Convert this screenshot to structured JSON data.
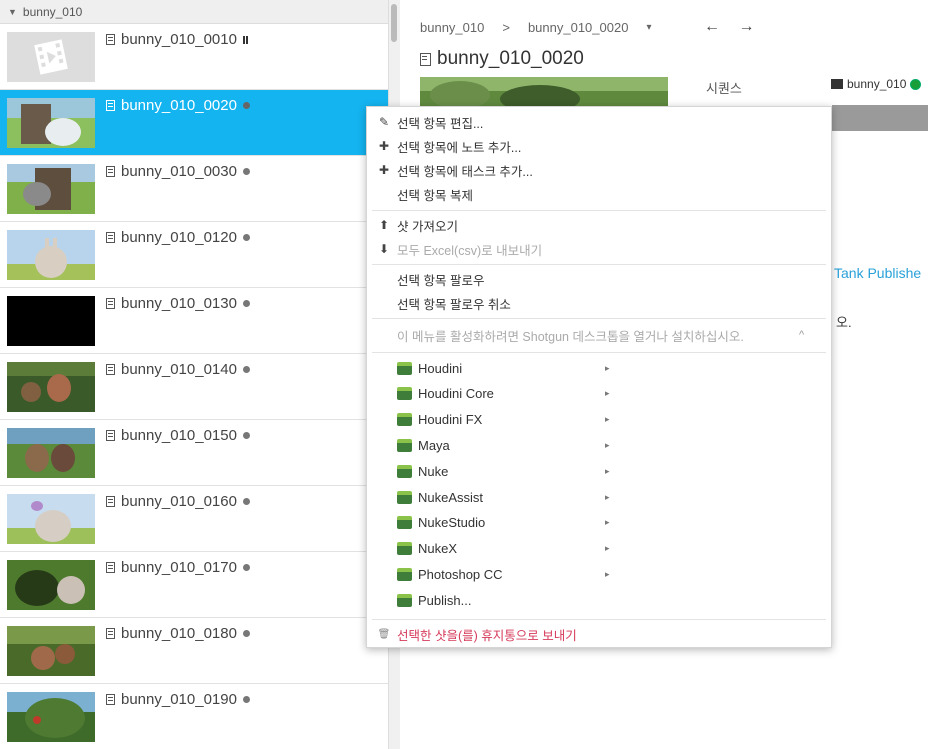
{
  "left_panel": {
    "group_label": "bunny_010",
    "rows": [
      {
        "name": "bunny_010_0010",
        "status": "pause",
        "thumb": "placeholder"
      },
      {
        "name": "bunny_010_0020",
        "status": "dot",
        "thumb": "tree",
        "selected": true
      },
      {
        "name": "bunny_010_0030",
        "status": "dot",
        "thumb": "tree2"
      },
      {
        "name": "bunny_010_0120",
        "status": "dot",
        "thumb": "bunny-sky"
      },
      {
        "name": "bunny_010_0130",
        "status": "dot",
        "thumb": "black"
      },
      {
        "name": "bunny_010_0140",
        "status": "dot",
        "thumb": "forest"
      },
      {
        "name": "bunny_010_0150",
        "status": "dot",
        "thumb": "forest2"
      },
      {
        "name": "bunny_010_0160",
        "status": "dot",
        "thumb": "bunny-sky2"
      },
      {
        "name": "bunny_010_0170",
        "status": "dot",
        "thumb": "cave"
      },
      {
        "name": "bunny_010_0180",
        "status": "dot",
        "thumb": "forest3"
      },
      {
        "name": "bunny_010_0190",
        "status": "dot",
        "thumb": "tree3"
      }
    ]
  },
  "detail": {
    "breadcrumb_project": "bunny_010",
    "breadcrumb_sep": ">",
    "breadcrumb_shot": "bunny_010_0020",
    "breadcrumb_dropdown": "▾",
    "nav_prev": "←",
    "nav_next": "→",
    "title": "bunny_010_0020",
    "sequence_label": "시퀀스",
    "sequence_value": "bunny_010",
    "tank_text": "Tank Publishe",
    "partial_text": "오."
  },
  "context_menu": {
    "items": [
      {
        "label": "선택 항목 편집...",
        "icon": "pencil-icon"
      },
      {
        "label": "선택 항목에 노트 추가...",
        "icon": "note-add-icon"
      },
      {
        "label": "선택 항목에 태스크 추가...",
        "icon": "task-add-icon"
      },
      {
        "label": "선택 항목 복제",
        "icon": ""
      },
      {
        "label": "샷 가져오기",
        "icon": "import-icon"
      },
      {
        "label": "모두 Excel(csv)로 내보내기",
        "icon": "export-icon",
        "disabled": true
      },
      {
        "label": "선택 항목 팔로우",
        "icon": ""
      },
      {
        "label": "선택 항목 팔로우 취소",
        "icon": ""
      },
      {
        "label": "이 메뉴를 활성화하려면 Shotgun 데스크톱을 열거나 설치하십시오.",
        "icon": "",
        "disabled": true
      }
    ],
    "apps": [
      {
        "label": "Houdini",
        "submenu": true
      },
      {
        "label": "Houdini Core",
        "submenu": true
      },
      {
        "label": "Houdini FX",
        "submenu": true
      },
      {
        "label": "Maya",
        "submenu": true
      },
      {
        "label": "Nuke",
        "submenu": true
      },
      {
        "label": "NukeAssist",
        "submenu": true
      },
      {
        "label": "NukeStudio",
        "submenu": true
      },
      {
        "label": "NukeX",
        "submenu": true
      },
      {
        "label": "Photoshop CC",
        "submenu": true
      },
      {
        "label": "Publish...",
        "submenu": false
      }
    ],
    "trash_label": "선택한 샷을(를) 휴지통으로 보내기",
    "submenu_arrow": "▸",
    "collapse_caret": "^"
  },
  "colors": {
    "selection": "#14b4f0",
    "danger": "#d63a5a",
    "link": "#29a1d8"
  }
}
